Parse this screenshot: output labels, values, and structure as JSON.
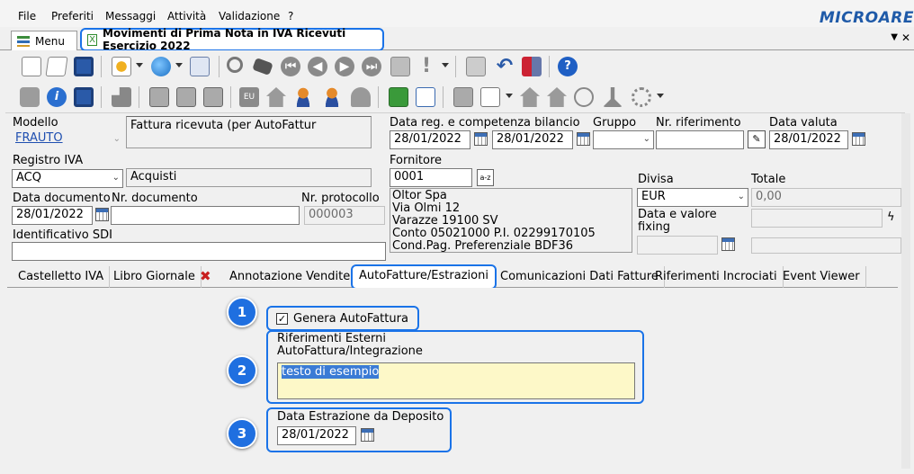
{
  "menubar": {
    "items": [
      "File",
      "Preferiti",
      "Messaggi",
      "Attività",
      "Validazione",
      "?"
    ],
    "brand": "MICROARE"
  },
  "tabs": {
    "menu_label": "Menu",
    "doc_title": "Movimenti di Prima Nota in IVA Ricevuti Esercizio 2022",
    "close_glyph": "X"
  },
  "form": {
    "modello_label": "Modello",
    "modello_value": "FRAUTO",
    "modello_desc": "Fattura ricevuta (per AutoFattur",
    "data_reg_label": "Data reg. e competenza bilancio",
    "data_reg_value": "28/01/2022",
    "data_comp_value": "28/01/2022",
    "gruppo_label": "Gruppo",
    "nr_rif_label": "Nr. riferimento",
    "data_valuta_label": "Data valuta",
    "data_valuta_value": "28/01/2022",
    "registro_label": "Registro IVA",
    "registro_value": "ACQ",
    "registro_desc": "Acquisti",
    "fornitore_label": "Fornitore",
    "fornitore_value": "0001",
    "fornitore_lines": [
      "Oltor Spa",
      "Via Olmi 12",
      "Varazze 19100 SV",
      "Conto 05021000 P.I. 02299170105",
      "Cond.Pag. Preferenziale BDF36"
    ],
    "data_doc_label": "Data documento",
    "data_doc_value": "28/01/2022",
    "nr_doc_label": "Nr. documento",
    "nr_prot_label": "Nr. protocollo",
    "nr_prot_value": "000003",
    "sdi_label": "Identificativo SDI",
    "divisa_label": "Divisa",
    "divisa_value": "EUR",
    "totale_label": "Totale",
    "totale_value": "0,00",
    "fixing_label_1": "Data e valore",
    "fixing_label_2": "fixing",
    "az_glyph": "a-z"
  },
  "subtabs": [
    "Castelletto IVA",
    "Libro Giornale",
    "Annotazione Vendite",
    "AutoFatture/Estrazioni",
    "Comunicazioni Dati Fatture",
    "Riferimenti Incrociati",
    "Event Viewer"
  ],
  "panel": {
    "badges": [
      "1",
      "2",
      "3"
    ],
    "genera_label": "Genera AutoFattura",
    "genera_checked": true,
    "rif_label_1": "Riferimenti Esterni",
    "rif_label_2": "AutoFattura/Integrazione",
    "rif_value": "testo di esempio",
    "data_estr_label": "Data Estrazione da Deposito",
    "data_estr_value": "28/01/2022"
  },
  "colors": {
    "highlight": "#1a73e8",
    "badge": "#1f6fe0",
    "note_bg": "#fdf8c8",
    "brand": "#1f5aa8"
  }
}
